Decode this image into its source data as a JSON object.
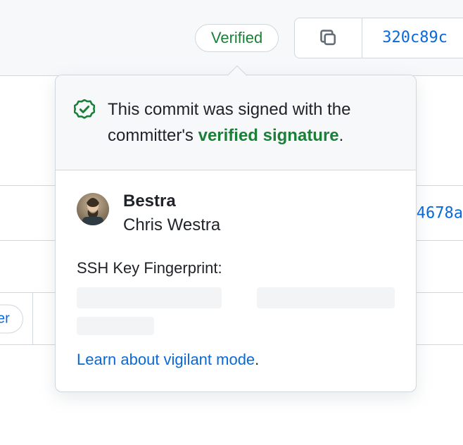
{
  "topbar": {
    "verified_label": "Verified",
    "commit_sha_short": "320c89c"
  },
  "background": {
    "row_sha_1": "4678a",
    "partial_pill": "er"
  },
  "popover": {
    "message_prefix": "This commit was signed with the committer's ",
    "verified_signature_link": "verified signature",
    "user": {
      "login": "Bestra",
      "name": "Chris Westra"
    },
    "fingerprint_label": "SSH Key Fingerprint:",
    "learn_link": "Learn about vigilant mode"
  },
  "colors": {
    "green": "#1a7f37",
    "link_blue": "#0969da",
    "border": "#d0d7de",
    "bg_subtle": "#f6f8fa"
  }
}
